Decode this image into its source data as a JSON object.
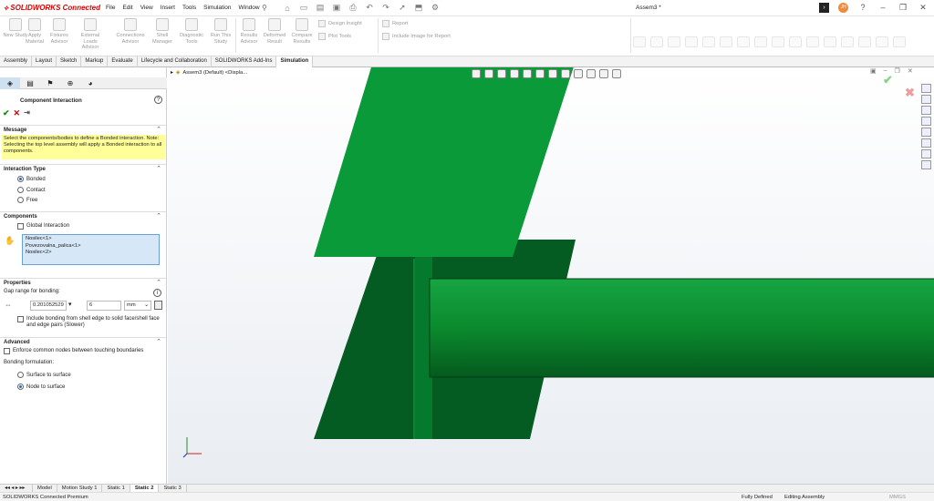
{
  "app": {
    "brand_prefix": "SOLIDWORKS",
    "brand_suffix": "Connected",
    "doc_title": "Assem3 *",
    "avatar_initials": "JH"
  },
  "menu": [
    "File",
    "Edit",
    "View",
    "Insert",
    "Tools",
    "Simulation",
    "Window"
  ],
  "ribbon": {
    "big": [
      {
        "label": "New Study"
      },
      {
        "label": "Apply Material"
      },
      {
        "label": "Fixtures Advisor"
      },
      {
        "label": "External Loads Advisor"
      },
      {
        "label": "Connections Advisor"
      },
      {
        "label": "Shell Manager"
      },
      {
        "label": "Diagnostic Tools"
      },
      {
        "label": "Run This Study"
      },
      {
        "label": "Results Advisor"
      },
      {
        "label": "Deformed Result"
      },
      {
        "label": "Compare Results"
      }
    ],
    "small": [
      "Design Insight",
      "Plot Tools",
      "Report",
      "Include Image for Report"
    ]
  },
  "tabs": [
    "Assembly",
    "Layout",
    "Sketch",
    "Markup",
    "Evaluate",
    "Lifecycle and Collaboration",
    "SOLIDWORKS Add-Ins",
    "Simulation"
  ],
  "panel": {
    "title": "Component Interaction",
    "message_header": "Message",
    "message": "Select the components/bodies to define a Bonded interaction. Note: Selecting the top level assembly will apply a Bonded interaction to all components.",
    "interaction_header": "Interaction Type",
    "interaction_types": [
      "Bonded",
      "Contact",
      "Free"
    ],
    "components_header": "Components",
    "global_interaction": "Global Interaction",
    "components": [
      "Nosilec<1>",
      "Povezovalna_palica<1>",
      "Nosilec<2>"
    ],
    "properties_header": "Properties",
    "gap_label": "Gap range for bonding:",
    "gap_value": "0.201052529",
    "gap_max": "6",
    "unit": "mm",
    "include_shell": "Include bonding from shell edge to solid face/shell face and edge pairs (Slower)",
    "advanced_header": "Advanced",
    "enforce_nodes": "Enforce common nodes between touching boundaries",
    "bonding_label": "Bonding formulation:",
    "bonding_options": [
      "Surface to surface",
      "Node to surface"
    ]
  },
  "tree": {
    "item": "Assem3 (Default) <Displa..."
  },
  "bottom_tabs": [
    "Model",
    "Motion Study 1",
    "Static 1",
    "Static 2",
    "Static 3"
  ],
  "status": {
    "left": "SOLIDWORKS Connected Premium",
    "defined": "Fully Defined",
    "mode": "Editing Assembly",
    "units": "MMGS"
  },
  "colors": {
    "part_light": "#0a9a3a",
    "part_dark": "#045c22",
    "beam": "#0b8a2e",
    "message_bg": "#ffff99"
  }
}
